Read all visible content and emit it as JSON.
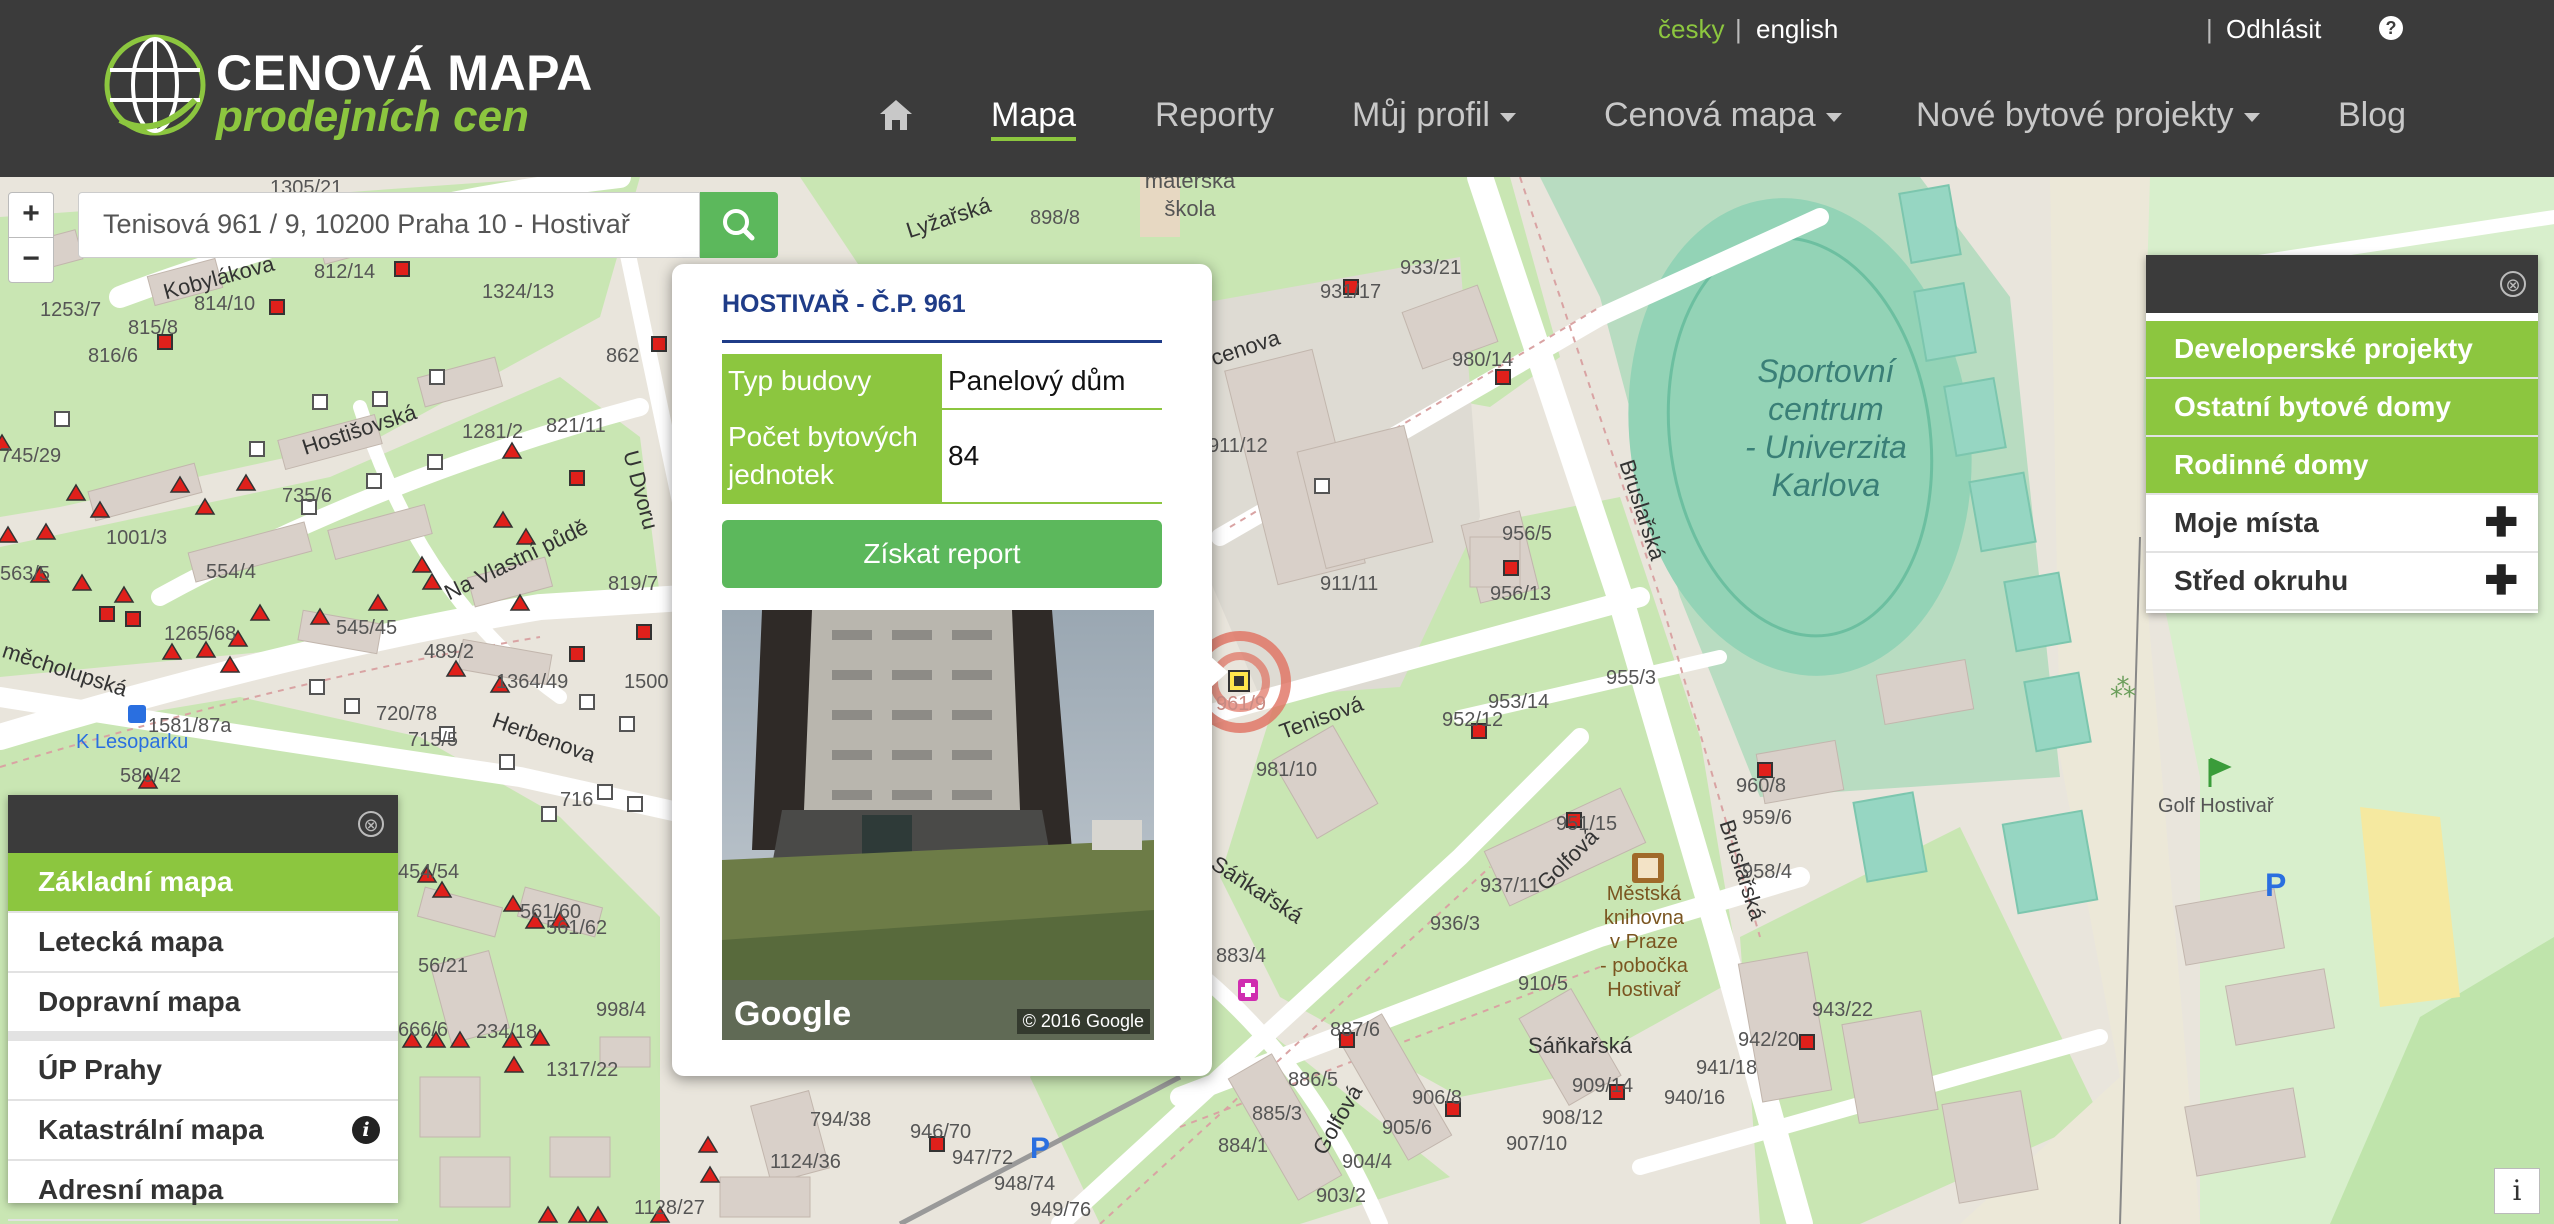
{
  "header": {
    "logo_title": "CENOVÁ MAPA",
    "logo_subtitle": "prodejních cen",
    "lang_cz": "česky",
    "lang_separator": "|",
    "lang_en": "english",
    "logout": "Odhlásit",
    "help_symbol": "?",
    "nav": {
      "home_icon": "home-icon",
      "mapa": "Mapa",
      "reporty": "Reporty",
      "muj_profil": "Můj profil",
      "cenova_mapa": "Cenová mapa",
      "nove_projekty": "Nové bytové projekty",
      "blog": "Blog"
    }
  },
  "search": {
    "value": "Tenisová 961 / 9, 10200 Praha 10 - Hostivař",
    "button_icon": "search-icon"
  },
  "zoom": {
    "in": "+",
    "out": "−"
  },
  "popup": {
    "title": "HOSTIVAŘ - Č.P. 961",
    "rows": [
      {
        "key": "Typ budovy",
        "value": "Panelový dům"
      },
      {
        "key": "Počet bytových jednotek",
        "value": "84"
      }
    ],
    "report_button": "Získat report",
    "photo_google": "Google",
    "photo_copyright": "© 2016 Google"
  },
  "layers_left": {
    "close_symbol": "⊗",
    "items": [
      "Základní mapa",
      "Letecká mapa",
      "Dopravní mapa",
      "ÚP Prahy",
      "Katastrální mapa",
      "Adresní mapa"
    ],
    "info_symbol": "i"
  },
  "layers_right": {
    "close_symbol": "⊗",
    "items": [
      "Developerské projekty",
      "Ostatní bytové domy",
      "Rodinné domy",
      "Moje místa",
      "Střed okruhu"
    ],
    "plus_symbol": "✚"
  },
  "map_info_symbol": "i",
  "map": {
    "streets": {
      "kobylakova": "Kobylákova",
      "hostisovska": "Hostišovská",
      "na_vlastni_pude": "Na Vlastní půdě",
      "u_dvoru": "U Dvoru",
      "herbenova": "Herbenova",
      "mecholupska": "měcholupská",
      "lyzarska": "Lyžařská",
      "bruslarska": "Bruslařská",
      "bruslarska2": "Bruslařská",
      "tenisova": "Tenisová",
      "sankarska": "Sáňkařská",
      "sankarska2": "Sáňkařská",
      "golfova": "Golfová",
      "golfova2": "Golfová",
      "cenova": "cenova"
    },
    "places": {
      "k_lesoparku": "K Lesoparku",
      "materska_skola": "mateřská\nškola",
      "golf_hostivar": "Golf Hostivař",
      "sport_centrum": "Sportovní\ncentrum\n- Univerzita\nKarlova",
      "knihovna": "Městská\nknihovna\nv Praze\n- pobočka\nHostivař"
    },
    "house_numbers": {
      "n812_14": "812/14",
      "n1253_7": "1253/7",
      "n814_10": "814/10",
      "n815_8": "815/8",
      "n816_6": "816/6",
      "n1324_13": "1324/13",
      "n1281_2": "1281/2",
      "n821_11": "821/11",
      "n745_29": "745/29",
      "n735_6": "735/6",
      "n1001_3": "1001/3",
      "n563_5": "563/5",
      "n819_7": "819/7",
      "n554_4": "554/4",
      "n1265_68": "1265/68",
      "n545_45": "545/45",
      "n489_2": "489/2",
      "n1581_87a": "1581/87a",
      "n1364_49": "1364/49",
      "n1500": "1500",
      "n720_78": "720/78",
      "n715_5": "715/5",
      "n716": "716",
      "n580_42": "580/42",
      "n898_8": "898/8",
      "n933_21": "933/21",
      "n931_17": "931/17",
      "n862": "862",
      "n980_14": "980/14",
      "n911_12": "911/12",
      "n911_11": "911/11",
      "n956_5": "956/5",
      "n956_13": "956/13",
      "n955_3": "955/3",
      "n953_14": "953/14",
      "n952_12": "952/12",
      "n981_10": "981/10",
      "n960_8": "960/8",
      "n959_6": "959/6",
      "n958_4": "958/4",
      "n951_15": "951/15",
      "n937_11": "937/11",
      "n936_3": "936/3",
      "n910_5": "910/5",
      "n883_4": "883/4",
      "n887_6": "887/6",
      "n886_5": "886/5",
      "n885_3": "885/3",
      "n884_1": "884/1",
      "n906_8": "906/8",
      "n905_6": "905/6",
      "n904_4": "904/4",
      "n903_2": "903/2",
      "n909_14": "909/14",
      "n908_12": "908/12",
      "n907_10": "907/10",
      "n943_22": "943/22",
      "n942_20": "942/20",
      "n941_18": "941/18",
      "n940_16": "940/16",
      "n946_70": "946/70",
      "n947_72": "947/72",
      "n948_74": "948/74",
      "n949_76": "949/76",
      "n794_38": "794/38",
      "n1124_36": "1124/36",
      "n1128_27": "1128/27",
      "n1317_22": "1317/22",
      "n998_4": "998/4",
      "n234_18": "234/18",
      "n454_54": "454/54",
      "n561_60": "561/60",
      "n561_62": "561/62",
      "n56_21": "56/21",
      "n666": "666/6",
      "n1305_21": "1305/21",
      "n961": "961/9"
    }
  }
}
